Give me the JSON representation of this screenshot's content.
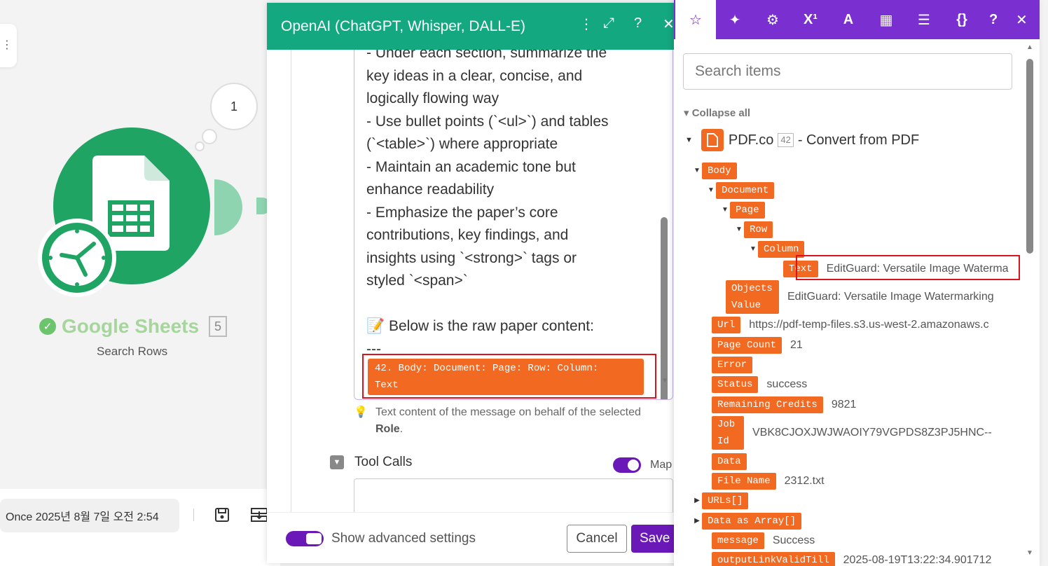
{
  "canvas": {
    "bubble_number": "1",
    "module": {
      "name": "Google Sheets",
      "badge": "5",
      "subtitle": "Search Rows"
    },
    "bottom_bar": {
      "schedule_text": "Once 2025년 8월 7일 오전 2:54"
    }
  },
  "openai_panel": {
    "title": "OpenAI (ChatGPT, Whisper, DALL-E)",
    "message_lines": [
      "- Under each section, summarize the",
      "key ideas in a clear, concise, and",
      "logically flowing way",
      "- Use bullet points (`<ul>`) and tables",
      "(`<table>`) where appropriate",
      "- Maintain an academic tone but",
      "enhance readability",
      "- Emphasize the paper’s core",
      "contributions, key findings, and",
      "insights using `<strong>` tags or",
      "styled `<span>`",
      "",
      "📝 Below is the raw paper content:",
      "---"
    ],
    "mapped_pill_line1": "42. Body: Document: Page: Row: Column:",
    "mapped_pill_line2": "Text",
    "hint_text": "Text content of the message on behalf of the selected",
    "hint_bold": "Role",
    "hint_end": ".",
    "tool_calls_label": "Tool Calls",
    "map_label": "Map",
    "show_advanced_label": "Show advanced settings",
    "cancel_label": "Cancel",
    "save_label": "Save"
  },
  "mapping_panel": {
    "search_placeholder": "Search items",
    "collapse_all": "Collapse all",
    "source": {
      "name": "PDF.co",
      "badge": "42",
      "suffix": "- Convert from PDF"
    },
    "tree": [
      {
        "label": "Body",
        "value": ""
      },
      {
        "label": "Document",
        "value": ""
      },
      {
        "label": "Page",
        "value": ""
      },
      {
        "label": "Row",
        "value": ""
      },
      {
        "label": "Column",
        "value": ""
      },
      {
        "label": "Text",
        "value": "EditGuard: Versatile Image Waterma"
      },
      {
        "label": "Objects Value",
        "value": "EditGuard: Versatile Image Watermarking"
      },
      {
        "label": "Url",
        "value": "https://pdf-temp-files.s3.us-west-2.amazonaws.c"
      },
      {
        "label": "Page Count",
        "value": "21"
      },
      {
        "label": "Error",
        "value": ""
      },
      {
        "label": "Status",
        "value": "success"
      },
      {
        "label": "Remaining Credits",
        "value": "9821"
      },
      {
        "label": "Job Id",
        "value": "VBK8CJOXJWJWAOIY79VGPDS8Z3PJ5HNC--"
      },
      {
        "label": "Data",
        "value": ""
      },
      {
        "label": "File Name",
        "value": "2312.txt"
      },
      {
        "label": "URLs[]",
        "value": ""
      },
      {
        "label": "Data as Array[]",
        "value": ""
      },
      {
        "label": "message",
        "value": "Success"
      },
      {
        "label": "outputLinkValidTill",
        "value": "2025-08-19T13:22:34.901712"
      }
    ]
  }
}
